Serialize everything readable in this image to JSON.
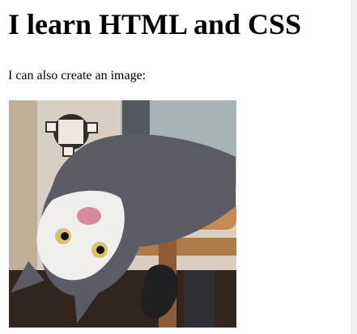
{
  "page": {
    "heading": "I learn HTML and CSS",
    "paragraph": "I can also create an image:"
  },
  "image": {
    "subject": "gray and white cat lying upside down on a wooden table edge",
    "colors": {
      "wall": "#d8cfc2",
      "cat_dark": "#4a4a52",
      "cat_light": "#f2f0ee",
      "nose": "#d98a9a",
      "wood": "#b07a48",
      "floor": "#3a2c24"
    }
  }
}
